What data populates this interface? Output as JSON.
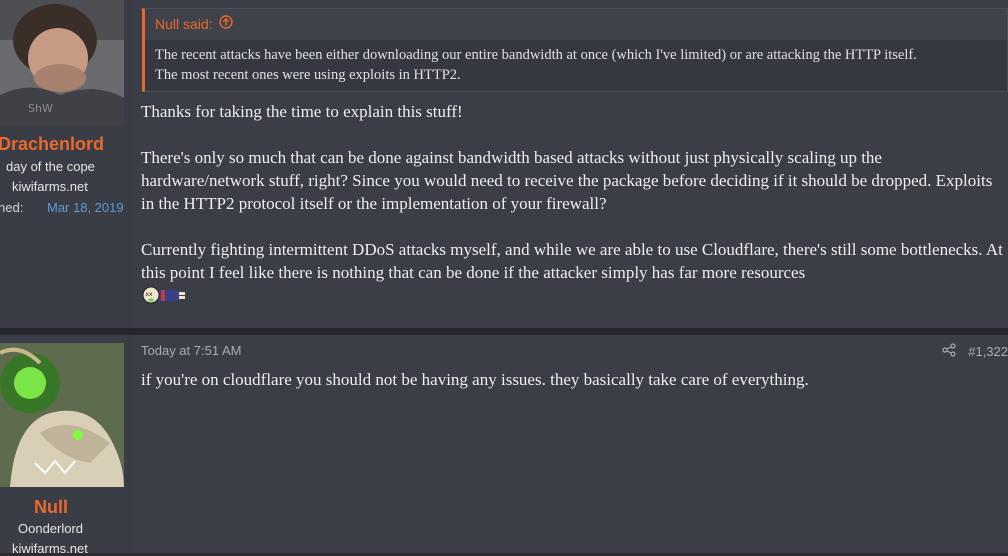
{
  "post1": {
    "author": {
      "name": "Drachenlord",
      "title": "day of the cope",
      "site": "kiwifarms.net",
      "joined_label": "ned:",
      "joined_value": "Mar 18, 2019"
    },
    "quote": {
      "header": "Null said:",
      "line1": "The recent attacks have been either downloading our entire bandwidth at once (which I've limited) or are attacking the HTTP itself.",
      "line2": "The most recent ones were using exploits in HTTP2."
    },
    "body": {
      "p1": "Thanks for taking the time to explain this stuff!",
      "p2": "There's only so much that can be done against bandwidth based attacks without just physically scaling up the hardware/network stuff, right? Since you would need to receive the package before deciding if it should be dropped. Exploits in the HTTP2 protocol itself or the implementation of your firewall?",
      "p3": "Currently fighting intermittent DDoS attacks myself, and while we are able to use Cloudflare, there's still some bottlenecks. At this point I feel like there is nothing that can be done if the attacker simply has far more resources"
    },
    "icons": {
      "quote_arrow": "arrow-up-circle-icon",
      "emoji": "dead-emoji-icon"
    }
  },
  "post2": {
    "author": {
      "name": "Null",
      "title": "Oonderlord",
      "site": "kiwifarms.net"
    },
    "meta": {
      "date": "Today at 7:51 AM",
      "post_number": "#1,322"
    },
    "body": {
      "p1": "if you're on cloudflare you should not be having any issues. they basically take care of everything."
    },
    "icons": {
      "share": "share-icon"
    }
  },
  "colors": {
    "accent": "#e8692b",
    "link": "#5b9bd6",
    "background": "#3b3e47"
  }
}
